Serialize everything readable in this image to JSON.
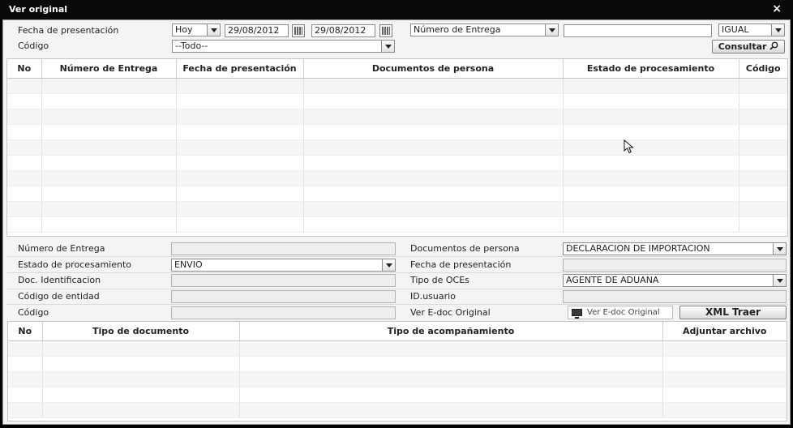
{
  "window": {
    "title": "Ver original",
    "close_glyph": "×"
  },
  "filters": {
    "fecha_label": "Fecha de presentación",
    "period_value": "Hoy",
    "date_from": "29/08/2012",
    "date_to": "29/08/2012",
    "field_select_value": "Número de Entrega",
    "search_value": "",
    "operator_value": "IGUAL",
    "codigo_label": "Código",
    "codigo_value": "--Todo--",
    "consultar_label": "Consultar"
  },
  "main_table": {
    "columns": [
      "No",
      "Número de Entrega",
      "Fecha de presentación",
      "Documentos de persona",
      "Estado de procesamiento",
      "Código"
    ],
    "rows": [
      [],
      [],
      [],
      [],
      [],
      [],
      [],
      [],
      [],
      []
    ]
  },
  "detail": {
    "numero_entrega_label": "Número de Entrega",
    "numero_entrega_value": "",
    "estado_label": "Estado de procesamiento",
    "estado_value": "ENVIO",
    "doc_ident_label": "Doc. Identificacion",
    "doc_ident_value": "",
    "codigo_entidad_label": "Código de entidad",
    "codigo_entidad_value": "",
    "codigo_label": "Código",
    "codigo_value": "",
    "documentos_label": "Documentos de persona",
    "documentos_value": "DECLARACION DE IMPORTACION",
    "fecha_label": "Fecha de presentación",
    "fecha_value": "",
    "tipo_oces_label": "Tipo de OCEs",
    "tipo_oces_value": "AGENTE DE ADUANA",
    "id_usuario_label": "ID.usuario",
    "id_usuario_value": "",
    "ver_edoc_label": "Ver E-doc Original",
    "ver_edoc_button": "Ver E-doc Original",
    "xml_traer_button": "XML Traer"
  },
  "docs_table": {
    "columns": [
      "No",
      "Tipo de documento",
      "Tipo de acompañamiento",
      "Adjuntar archivo"
    ],
    "rows": [
      [],
      [],
      [],
      [],
      []
    ]
  },
  "icons": {
    "calendar": "calendar-icon",
    "dropdown": "chevron-down-icon",
    "search": "search-icon",
    "monitor": "monitor-icon",
    "cursor": "mouse-cursor-icon"
  }
}
